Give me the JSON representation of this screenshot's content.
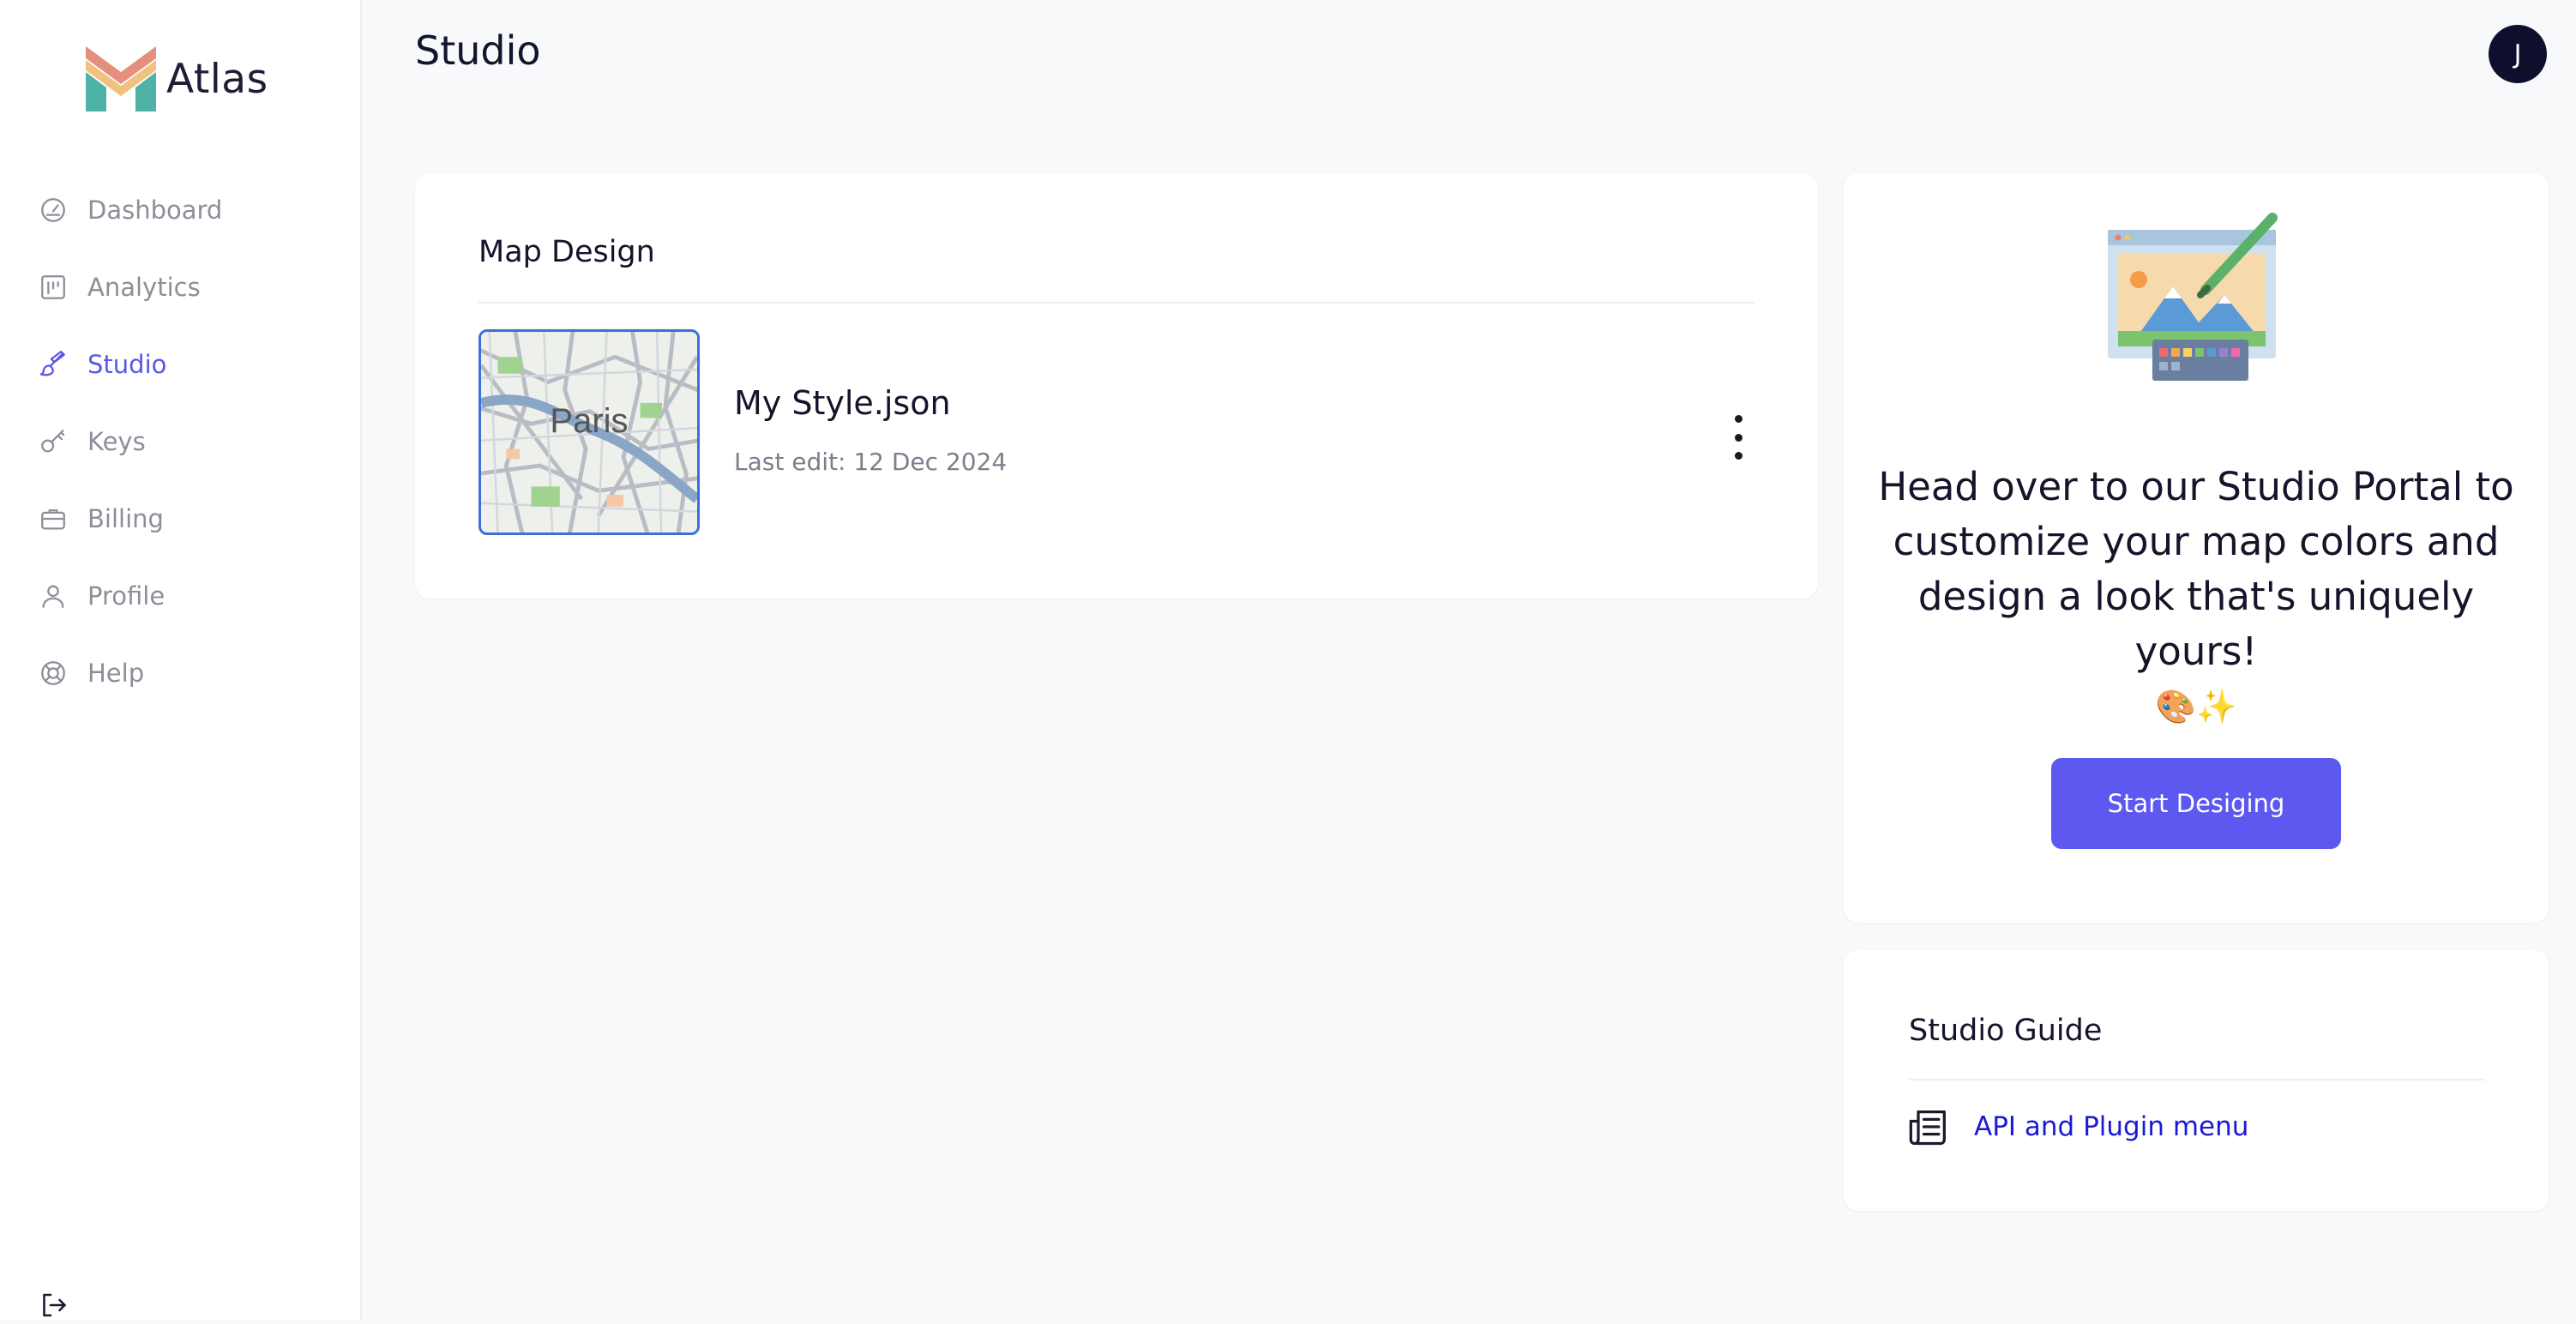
{
  "app": {
    "name": "Atlas"
  },
  "sidebar": {
    "items": [
      {
        "label": "Dashboard",
        "icon": "gauge-icon",
        "active": false
      },
      {
        "label": "Analytics",
        "icon": "chart-icon",
        "active": false
      },
      {
        "label": "Studio",
        "icon": "brush-icon",
        "active": true
      },
      {
        "label": "Keys",
        "icon": "key-icon",
        "active": false
      },
      {
        "label": "Billing",
        "icon": "briefcase-icon",
        "active": false
      },
      {
        "label": "Profile",
        "icon": "user-icon",
        "active": false
      },
      {
        "label": "Help",
        "icon": "lifebuoy-icon",
        "active": false
      }
    ],
    "logout_icon": "logout-icon"
  },
  "header": {
    "title": "Studio",
    "avatar_initial": "J"
  },
  "map_design": {
    "heading": "Map Design",
    "file": {
      "thumbnail_label": "Paris",
      "name": "My Style.json",
      "meta": "Last edit: 12 Dec 2024"
    }
  },
  "promo": {
    "text": "Head over to our Studio Portal to customize your map colors and design a look that's uniquely yours!",
    "emoji": "🎨✨",
    "button_label": "Start Desiging"
  },
  "guide": {
    "heading": "Studio Guide",
    "link_label": "API and Plugin menu",
    "link_icon": "newspaper-icon"
  },
  "colors": {
    "accent": "#5d58f0",
    "active_nav": "#5a57e6",
    "link": "#1a1ad6",
    "avatar_bg": "#0f0f2d"
  }
}
